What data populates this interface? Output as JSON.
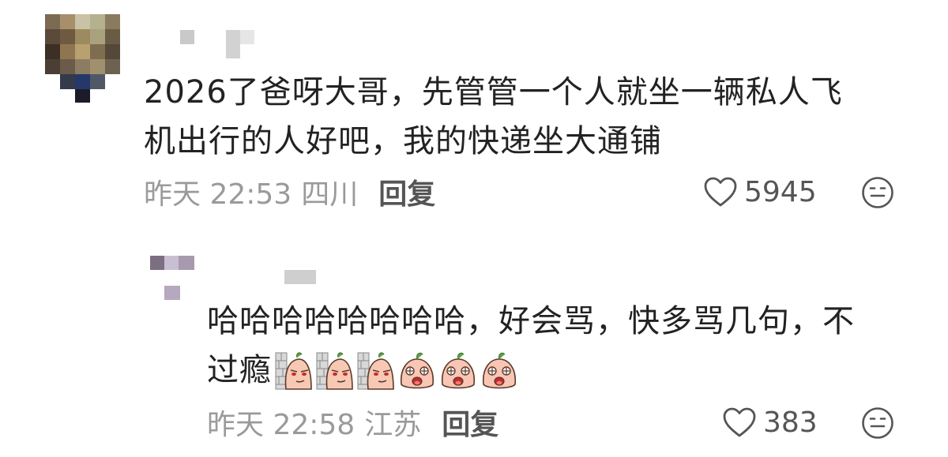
{
  "comments": [
    {
      "text_line1": "2026了爸呀大哥，先管管一个人就坐一辆私人飞",
      "text_line2": "机出行的人好吧，我的快递坐大通铺",
      "time": "昨天 22:53",
      "location": "四川",
      "reply_label": "回复",
      "likes": "5945"
    },
    {
      "text_line1": "哈哈哈哈哈哈哈哈，好会骂，快多骂几句，不",
      "text_line2": "过瘾",
      "stickers": [
        "smirk-wall-sticker",
        "smirk-wall-sticker",
        "smirk-wall-sticker",
        "surprised-peach-sticker",
        "surprised-peach-sticker",
        "surprised-peach-sticker"
      ],
      "time": "昨天 22:58",
      "location": "江苏",
      "reply_label": "回复",
      "likes": "383"
    }
  ],
  "icons": {
    "like": "heart-outline-icon",
    "emoji": "neutral-face-icon"
  },
  "colors": {
    "text": "#222222",
    "meta": "#9a9a9a",
    "action": "#555555"
  }
}
